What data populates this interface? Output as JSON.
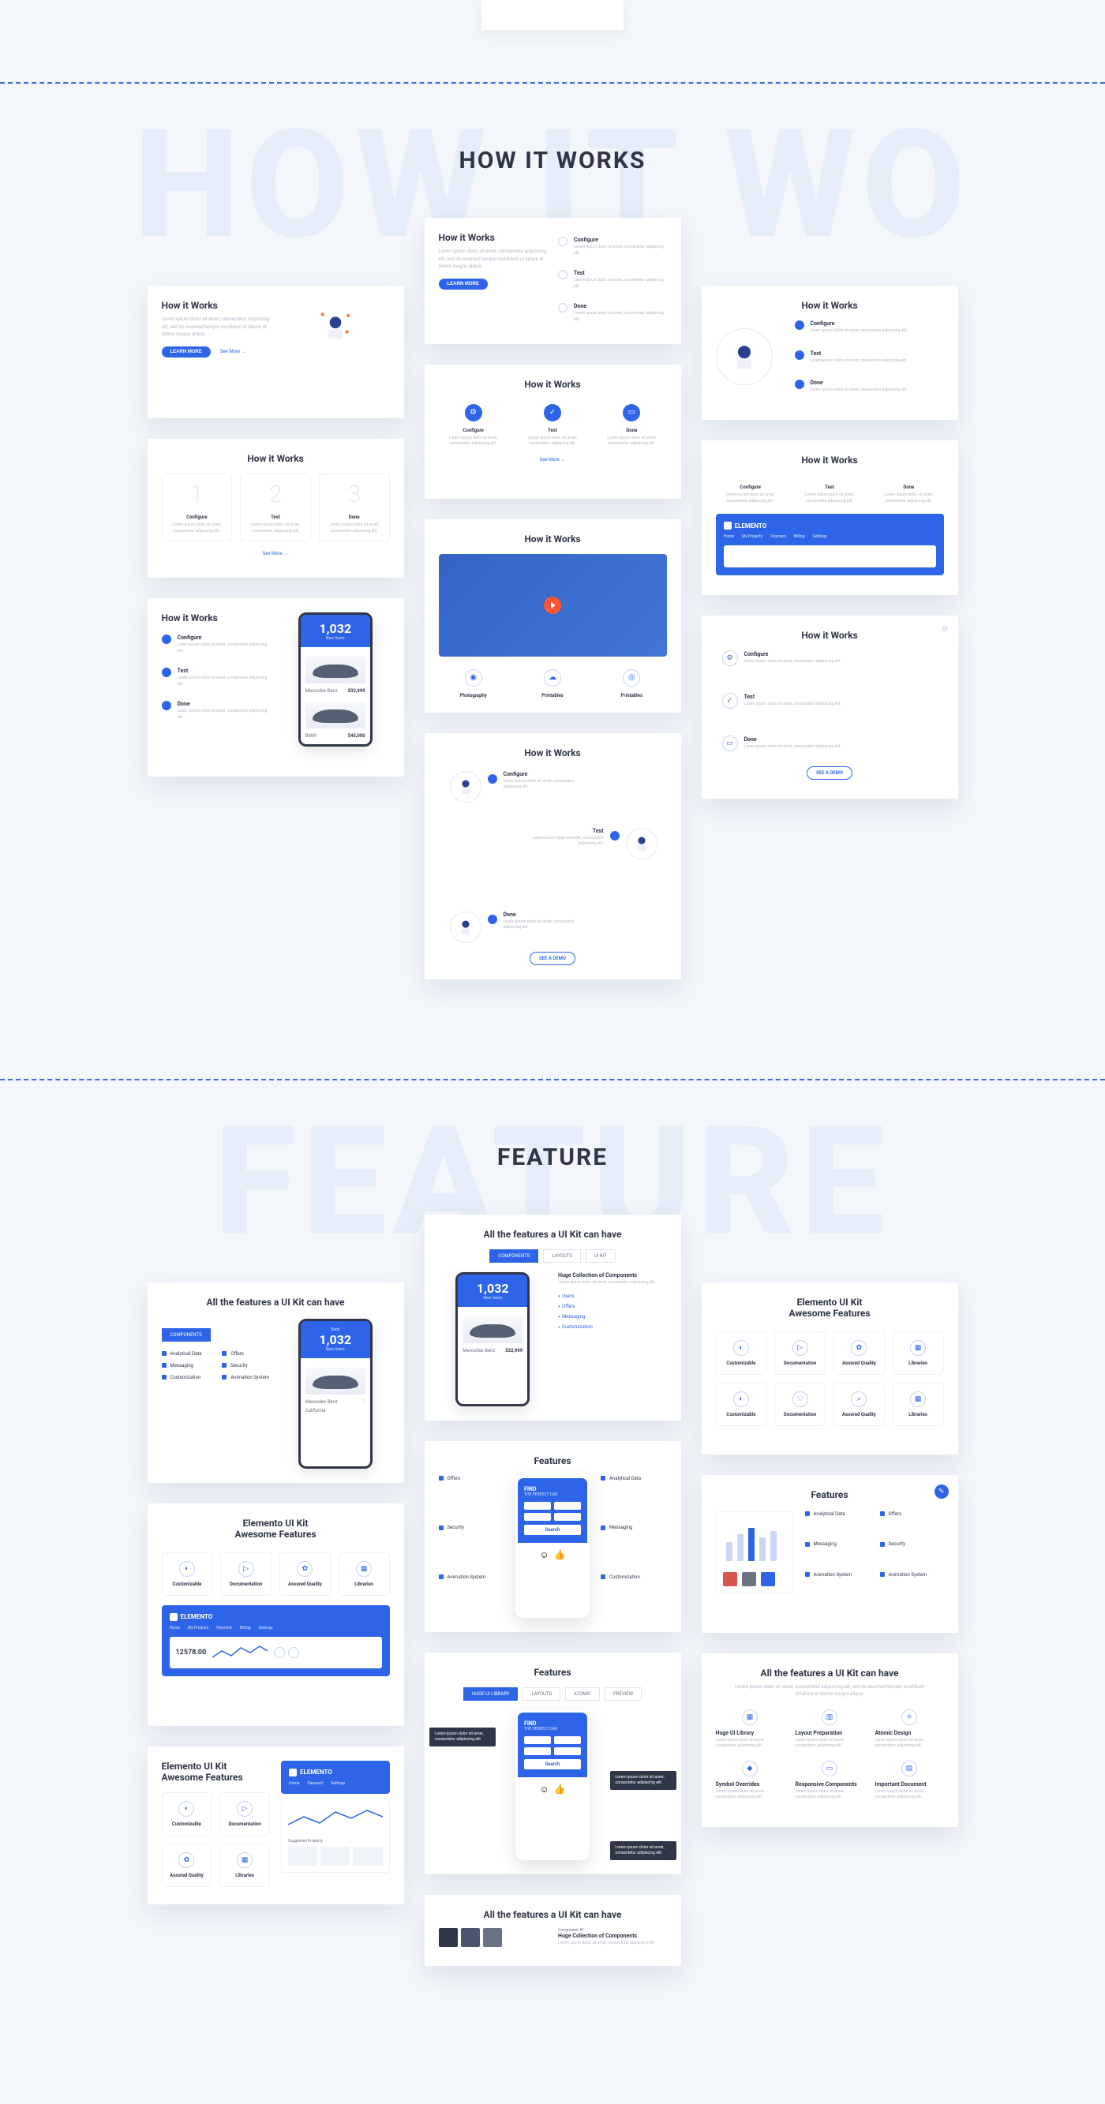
{
  "sections": {
    "howItWorks": {
      "bgText": "HOW IT WO",
      "title": "HOW IT WORKS"
    },
    "feature": {
      "bgText": "FEATURE",
      "title": "FEATURE"
    }
  },
  "common": {
    "cardTitle": "How it Works",
    "lorem": "Lorem ipsum dolor sit amet, consectetur adipiscing elit, sed do eiusmod tempor incididunt ut labore et dolore magna aliqua.",
    "loremShort": "Lorem ipsum dolor sit amet, consectetur adipiscing elit.",
    "btnLearnMore": "LEARN MORE",
    "linkSeeMore": "See More →",
    "btnSeeMore": "SEE A DEMO",
    "steps": {
      "s1": "Configure",
      "s2": "Test",
      "s3": "Done"
    },
    "iconLabels": {
      "a": "Photography",
      "b": "Printables",
      "c": "Printables"
    },
    "hiwIcons": {
      "a": "Configure",
      "b": "Test",
      "c": "Done"
    }
  },
  "phone": {
    "statValue": "1,032",
    "statLabel": "New Users",
    "brand1": "Mercedes Benz",
    "price1": "$32,999",
    "brand2": "BMW",
    "price2": "$45,000",
    "location": "California"
  },
  "dashboard": {
    "brand": "ELEMENTO",
    "nav": [
      "Home",
      "My Projects",
      "Payment",
      "Billing",
      "Settings"
    ],
    "metric": "12578.00"
  },
  "features": {
    "titleAll": "All the features a UI Kit can have",
    "titleElemento": "Elemento UI Kit",
    "subtitleElemento": "Awesome Features",
    "titleShort": "Features",
    "hugeCollection": "Huge Collection of Components",
    "cells": {
      "c1": "Customizable",
      "c2": "Documentation",
      "c3": "Assured Quality",
      "c4": "Libraries"
    },
    "list": {
      "l1": "Analytical Data",
      "l2": "Offers",
      "l3": "Messaging",
      "l4": "Security",
      "l5": "Customization",
      "l6": "Animation System"
    },
    "list2": {
      "l1": "Huge UI Library",
      "l2": "Layout Preparation",
      "l3": "Atomic Design",
      "l4": "Symbol Overrides",
      "l5": "Responsive Components",
      "l6": "Important Document"
    },
    "tabs": {
      "t1": "COMPONENTS",
      "t2": "LAYOUTS",
      "t3": "UI KIT"
    },
    "tabs2": {
      "t1": "HUGE UI LIBRARY",
      "t2": "LAYOUTS",
      "t3": "ATOMIC",
      "t4": "PREVIEW"
    }
  },
  "find": {
    "title": "FIND",
    "subtitle": "THE PERFECT CAR",
    "btn": "Search"
  }
}
